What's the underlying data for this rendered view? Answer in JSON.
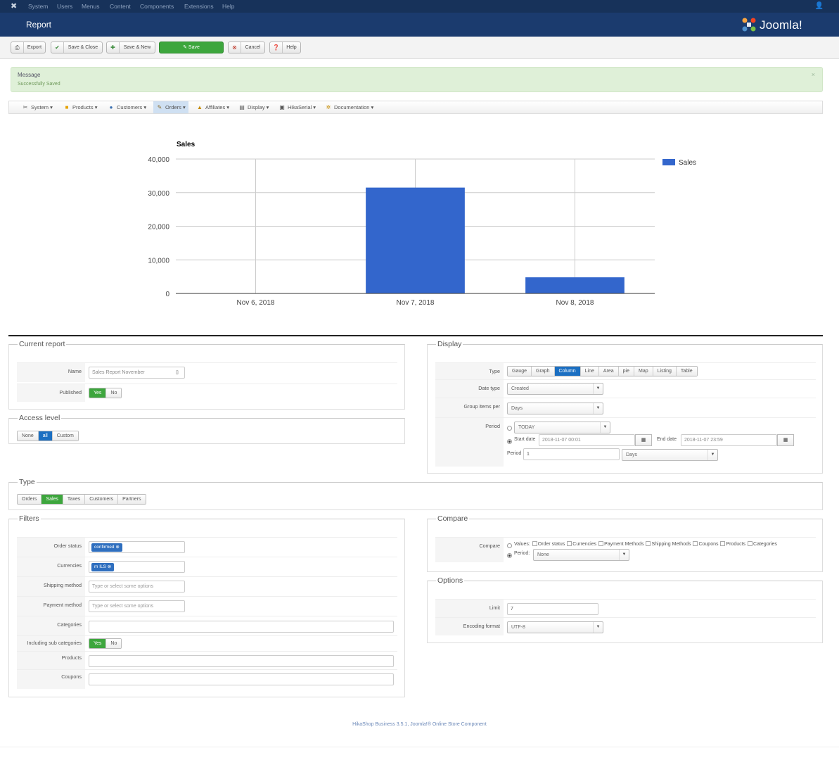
{
  "topmenu": {
    "items": [
      "System",
      "Users",
      "Menus",
      "Content",
      "Components",
      "Extensions",
      "Help"
    ]
  },
  "header": {
    "title": "Report",
    "brand": "Joomla!"
  },
  "toolbar": {
    "export": "Export",
    "save_close": "Save & Close",
    "save_new": "Save & New",
    "save": "Save",
    "cancel": "Cancel",
    "help": "Help"
  },
  "message": {
    "heading": "Message",
    "text": "Successfully Saved",
    "close": "×"
  },
  "submenu": {
    "items": [
      "System",
      "Products",
      "Customers",
      "Orders",
      "Affiliates",
      "Display",
      "HikaSerial",
      "Documentation"
    ],
    "active": "Orders"
  },
  "chart_data": {
    "type": "bar",
    "title": "Sales",
    "categories": [
      "Nov 6, 2018",
      "Nov 7, 2018",
      "Nov 8, 2018"
    ],
    "series": [
      {
        "name": "Sales",
        "values": [
          0,
          31500,
          4800
        ],
        "color": "#3366cc"
      }
    ],
    "ylim": [
      0,
      40000
    ],
    "yticks": [
      "0",
      "10,000",
      "20,000",
      "30,000",
      "40,000"
    ],
    "grid": true,
    "legend": "right"
  },
  "current_report": {
    "legend": "Current report",
    "name_label": "Name",
    "name_value": "Sales Report November",
    "published_label": "Published",
    "yes": "Yes",
    "no": "No"
  },
  "access": {
    "legend": "Access level",
    "options": [
      "None",
      "all",
      "Custom"
    ],
    "active": "all"
  },
  "display": {
    "legend": "Display",
    "type_label": "Type",
    "types": [
      "Gauge",
      "Graph",
      "Column",
      "Line",
      "Area",
      "pie",
      "Map",
      "Listing",
      "Table"
    ],
    "active_type": "Column",
    "date_type_label": "Date type",
    "date_type": "Created",
    "group_label": "Group items per",
    "group": "Days",
    "period_label": "Period",
    "period_option": "TODAY",
    "start_label": "Start date",
    "start_value": "2018-11-07 00:01",
    "end_label": "End date",
    "end_value": "2018-11-07 23:59",
    "period_field_label": "Period",
    "period_value": "1",
    "period_unit": "Days"
  },
  "type_section": {
    "legend": "Type",
    "options": [
      "Orders",
      "Sales",
      "Taxes",
      "Customers",
      "Partners"
    ],
    "active": "Sales"
  },
  "filters": {
    "legend": "Filters",
    "order_status_label": "Order status",
    "order_status_chip": "confirmed",
    "currencies_label": "Currencies",
    "currencies_chip": "m ILS",
    "shipping_label": "Shipping method",
    "shipping_placeholder": "Type or select some options",
    "payment_label": "Payment method",
    "payment_placeholder": "Type or select some options",
    "categories_label": "Categories",
    "sub_label": "Including sub categories",
    "yes": "Yes",
    "no": "No",
    "products_label": "Products",
    "coupons_label": "Coupons"
  },
  "compare": {
    "legend": "Compare",
    "label": "Compare",
    "values_label": "Values:",
    "values": [
      "Order status",
      "Currencies",
      "Payment Methods",
      "Shipping Methods",
      "Coupons",
      "Products",
      "Categories"
    ],
    "period_label": "Period:",
    "period_value": "None"
  },
  "options": {
    "legend": "Options",
    "limit_label": "Limit",
    "limit_value": "7",
    "encoding_label": "Encoding format",
    "encoding_value": "UTF-8"
  },
  "footer": "HikaShop Business 3.5.1, Joomla!® Online Store Component"
}
